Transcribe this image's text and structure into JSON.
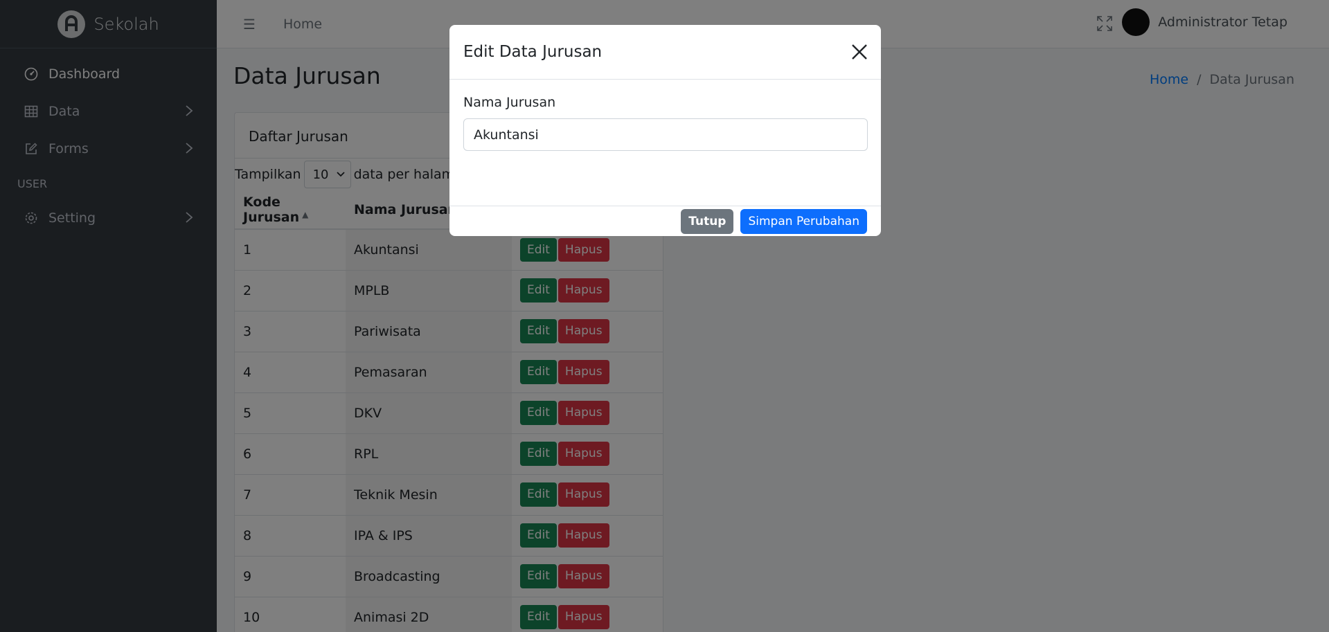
{
  "brand": {
    "name": "Sekolah"
  },
  "sidebar": {
    "items": [
      {
        "label": "Dashboard"
      },
      {
        "label": "Data"
      },
      {
        "label": "Forms"
      }
    ],
    "section_header": "USER",
    "user_items": [
      {
        "label": "Setting"
      }
    ]
  },
  "navbar": {
    "home": "Home",
    "user_name": "Administrator Tetap"
  },
  "page": {
    "title": "Data Jurusan",
    "breadcrumb": {
      "home": "Home",
      "sep": "/",
      "current": "Data Jurusan"
    }
  },
  "card": {
    "title": "Daftar Jurusan",
    "show_label": "Tampilkan",
    "per_page_value": "10",
    "per_page_suffix": "data per halaman"
  },
  "table": {
    "headers": {
      "kode": "Kode Jurusan",
      "nama": "Nama Jurusan"
    },
    "edit_label": "Edit",
    "delete_label": "Hapus",
    "rows": [
      {
        "kode": "1",
        "nama": "Akuntansi"
      },
      {
        "kode": "2",
        "nama": "MPLB"
      },
      {
        "kode": "3",
        "nama": "Pariwisata"
      },
      {
        "kode": "4",
        "nama": "Pemasaran"
      },
      {
        "kode": "5",
        "nama": "DKV"
      },
      {
        "kode": "6",
        "nama": "RPL"
      },
      {
        "kode": "7",
        "nama": "Teknik Mesin"
      },
      {
        "kode": "8",
        "nama": "IPA & IPS"
      },
      {
        "kode": "9",
        "nama": "Broadcasting"
      },
      {
        "kode": "10",
        "nama": "Animasi 2D"
      }
    ]
  },
  "modal": {
    "title": "Edit Data Jurusan",
    "field_label": "Nama Jurusan",
    "field_value": "Akuntansi",
    "close_label": "Tutup",
    "save_label": "Simpan Perubahan"
  },
  "icons": {
    "brand": "logo-icon",
    "dashboard": "gauge-icon",
    "data": "table-icon",
    "forms": "edit-icon",
    "setting": "gear-icon",
    "menu": "hamburger-icon",
    "fullscreen": "expand-icon",
    "close": "close-icon"
  },
  "colors": {
    "primary": "#0d6efd",
    "edit": "#198754",
    "delete": "#dc3545",
    "secondary": "#6c757d",
    "sidebar": "#343a40"
  }
}
